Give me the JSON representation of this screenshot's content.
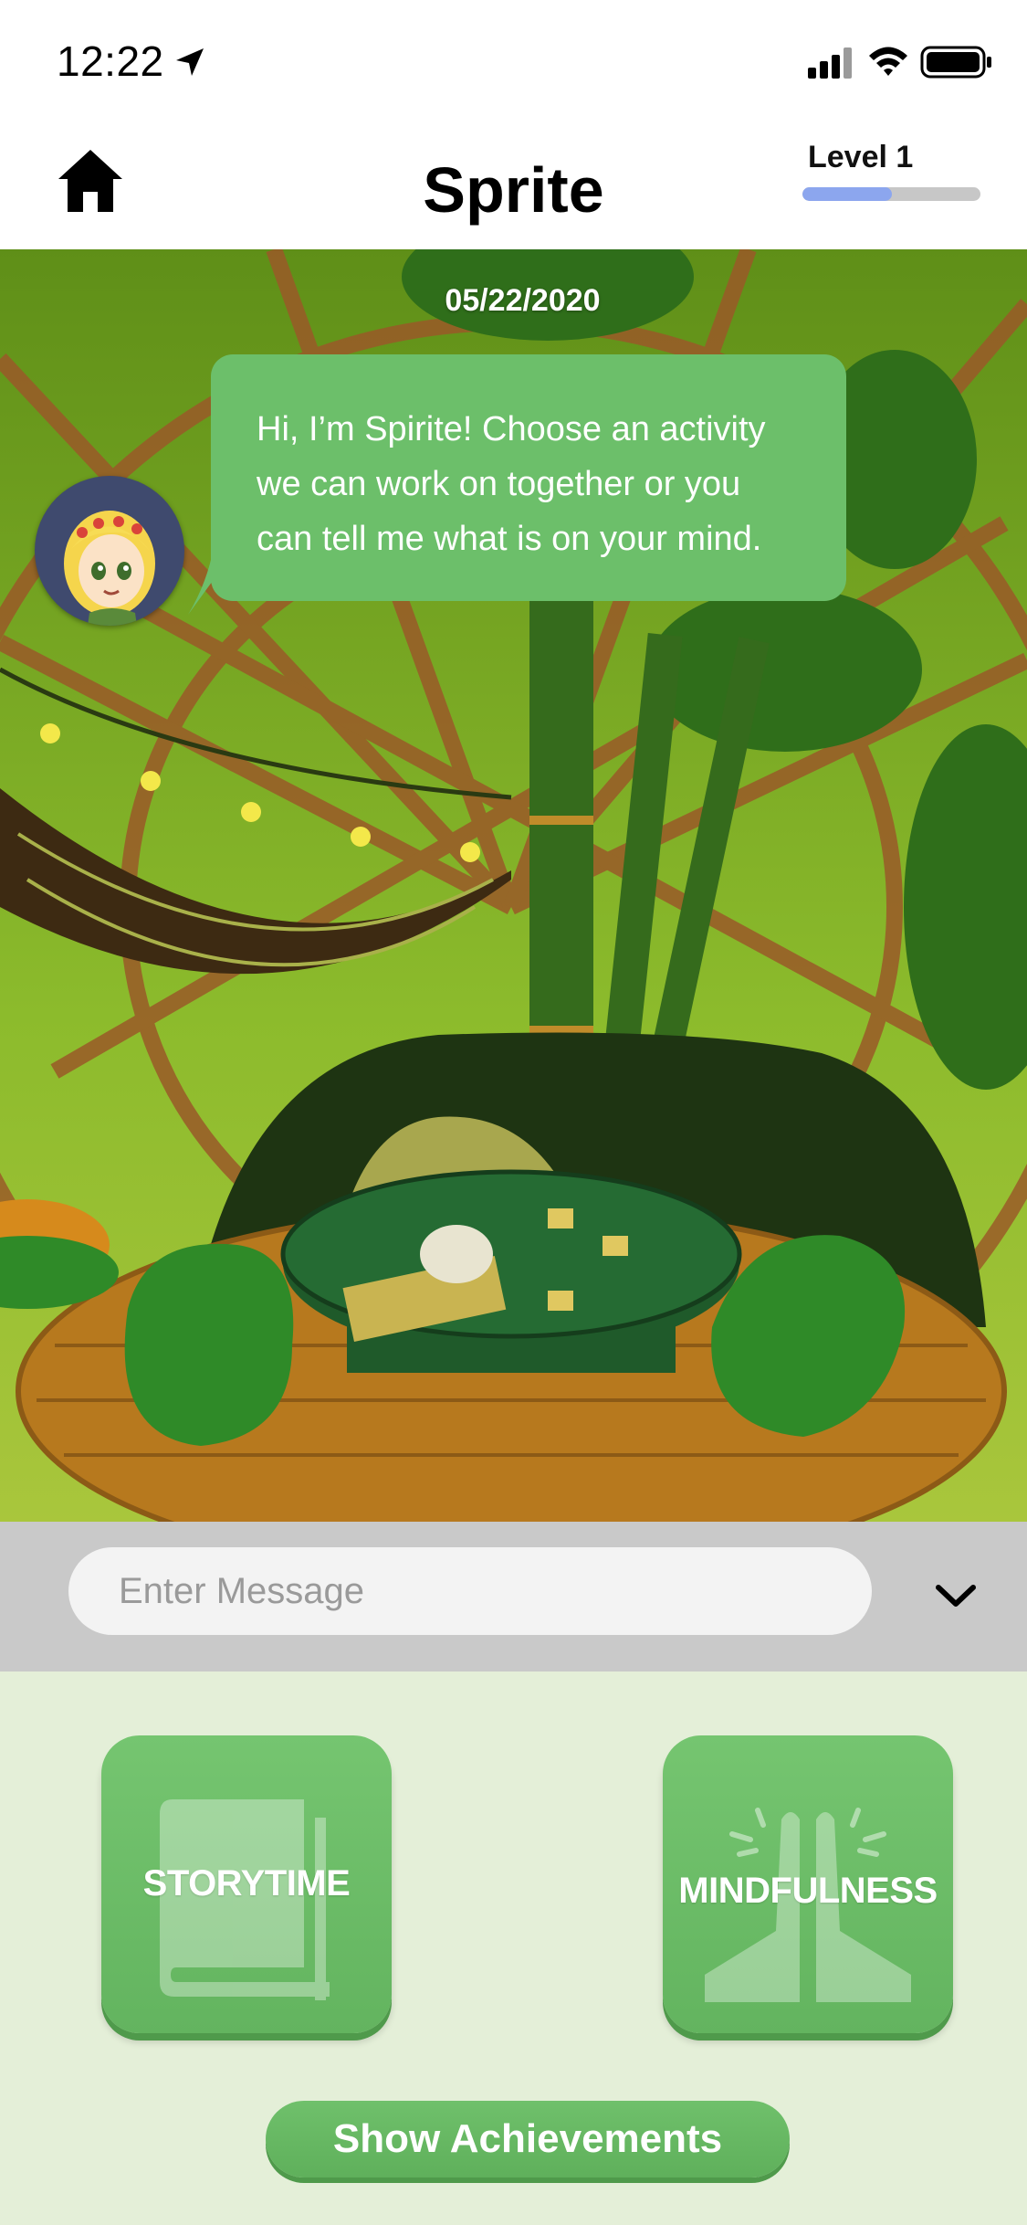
{
  "status_bar": {
    "time": "12:22",
    "icons": [
      "location-arrow-icon",
      "cellular-signal-icon",
      "wifi-icon",
      "battery-icon"
    ]
  },
  "header": {
    "title": "Sprite",
    "level_label": "Level 1",
    "level_progress": 0.5,
    "home_icon": "home-icon"
  },
  "chat": {
    "date": "05/22/2020",
    "message_lines": [
      "Hi, I’m Spirite! Choose an activity",
      "we can work on together or you",
      "can tell me what is on your mind."
    ]
  },
  "message_bar": {
    "placeholder": "Enter Message",
    "value": "",
    "toggle_icon": "chevron-down-icon"
  },
  "activities": [
    {
      "label": "STORYTIME",
      "icon": "book-icon"
    },
    {
      "label": "MINDFULNESS",
      "icon": "praying-hands-icon"
    }
  ],
  "achievements_button": "Show Achievements",
  "colors": {
    "accent_green": "#6cbf6a",
    "activity_bg": "#e4efd8",
    "level_fill": "#8ca6ee",
    "message_bar_bg": "#c9c9c9"
  }
}
